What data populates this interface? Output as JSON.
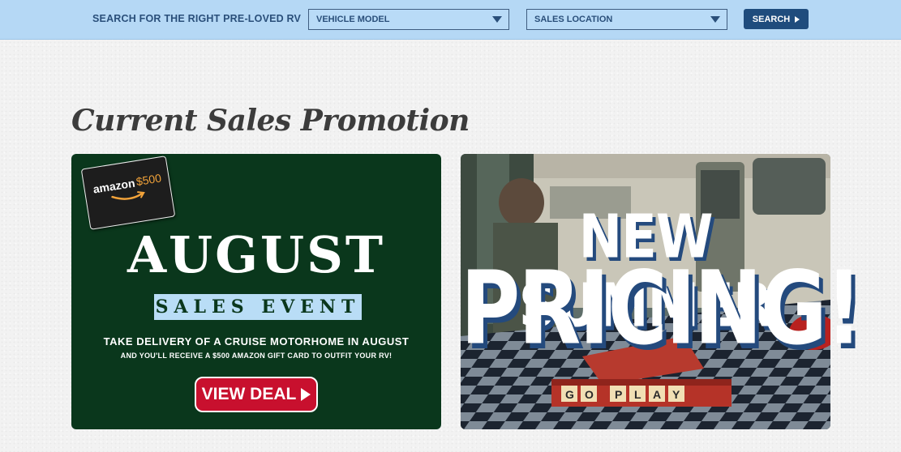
{
  "search": {
    "label": "SEARCH FOR THE RIGHT PRE-LOVED RV",
    "vehicle_model": "VEHICLE MODEL",
    "sales_location": "SALES LOCATION",
    "button": "SEARCH"
  },
  "section": {
    "title": "Current Sales Promotion"
  },
  "promo_august": {
    "gift_brand": "amazon",
    "gift_amount": "$500",
    "title": "AUGUST",
    "subtitle": "SALES EVENT",
    "line1": "TAKE DELIVERY OF A CRUISE MOTORHOME IN AUGUST",
    "line2": "AND YOU'LL RECEIVE A $500 AMAZON GIFT CARD TO OUTFIT YOUR RV!",
    "button": "VIEW DEAL"
  },
  "promo_summer": {
    "line1": "NEW SUMMER",
    "line2": "PRICING!",
    "tiles": "GO PLAY"
  },
  "colors": {
    "searchbar_bg": "#b5d8f5",
    "brand_navy": "#1f4c7d",
    "august_green": "#0a371c",
    "deal_red": "#c8102e"
  }
}
